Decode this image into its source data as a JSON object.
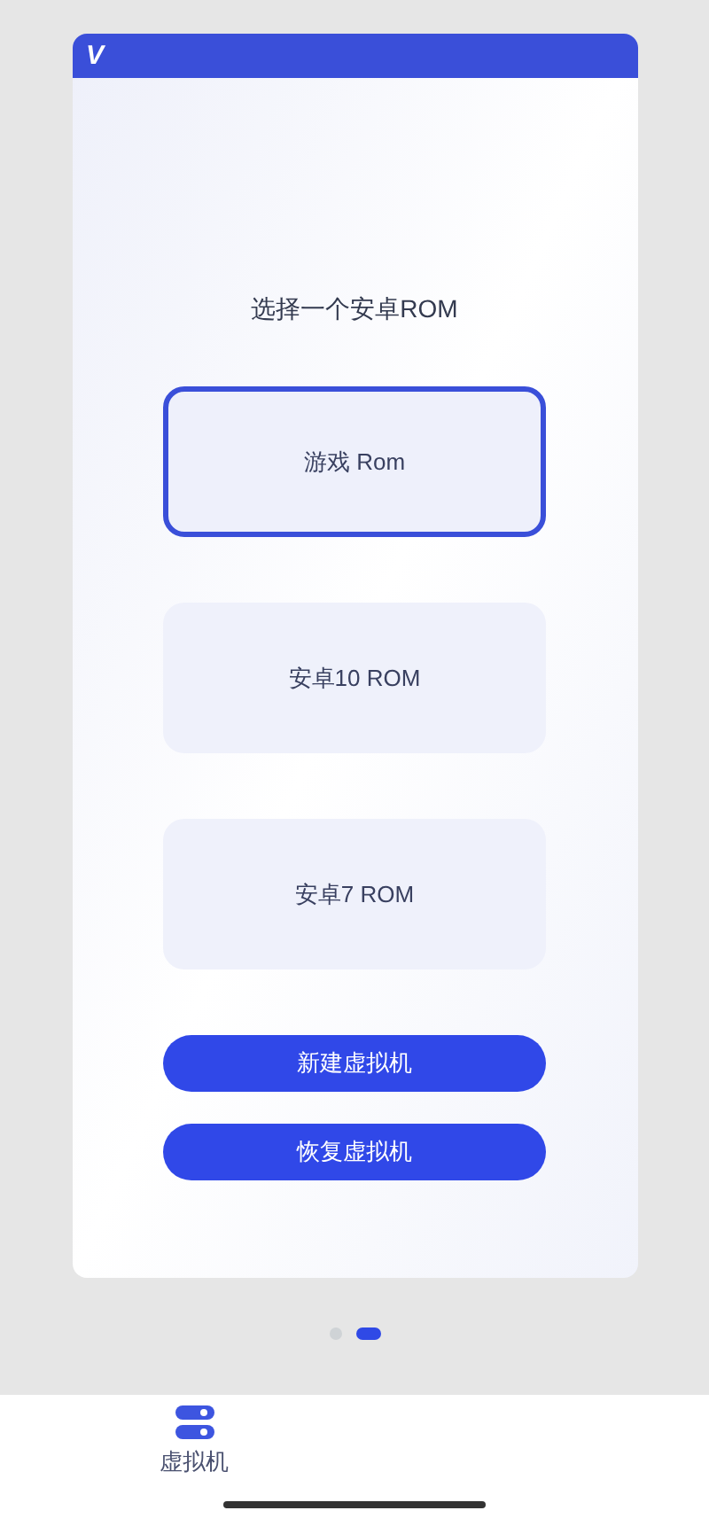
{
  "header": {
    "logo": "V"
  },
  "prompt": "选择一个安卓ROM",
  "roms": [
    {
      "label": "游戏 Rom",
      "selected": true
    },
    {
      "label": "安卓10 ROM",
      "selected": false
    },
    {
      "label": "安卓7 ROM",
      "selected": false
    }
  ],
  "buttons": [
    "新建虚拟机",
    "恢复虚拟机"
  ],
  "pager": [
    {
      "selected": false
    },
    {
      "selected": true
    }
  ],
  "bottom_nav": [
    {
      "label": "虚拟机",
      "selected": true
    }
  ]
}
